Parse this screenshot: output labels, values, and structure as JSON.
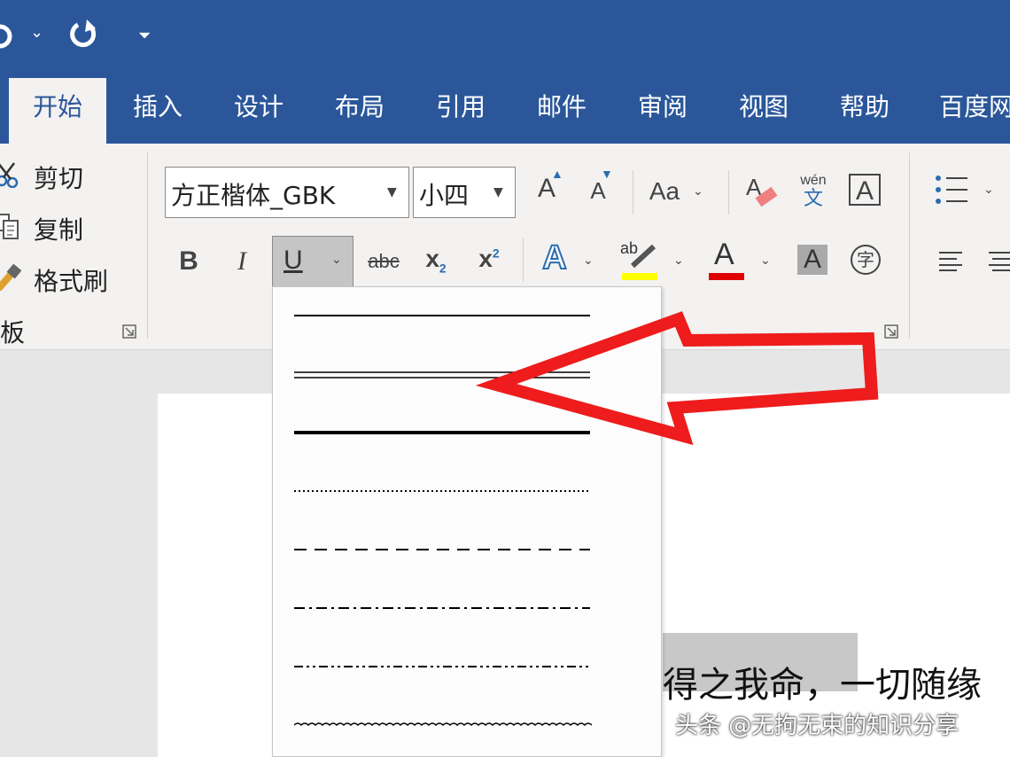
{
  "quick_access": {
    "undo_icon": "undo-icon",
    "redo_icon": "redo-icon",
    "customize_icon": "customize-qat-icon"
  },
  "tabs": [
    "开始",
    "插入",
    "设计",
    "布局",
    "引用",
    "邮件",
    "审阅",
    "视图",
    "帮助",
    "百度网"
  ],
  "active_tab": "开始",
  "clipboard": {
    "cut": "剪切",
    "copy": "复制",
    "format_painter": "格式刷",
    "group_label": "板"
  },
  "font": {
    "name": "方正楷体_GBK",
    "size": "小四",
    "grow_icon": "A",
    "shrink_icon": "A",
    "change_case": "Aa",
    "phonetic_top": "wén",
    "phonetic_bottom": "文",
    "border_char": "A",
    "bold": "B",
    "italic": "I",
    "underline": "U",
    "strike": "abc",
    "subscript": "x",
    "subscript_mark": "2",
    "superscript": "x",
    "superscript_mark": "2",
    "text_effect": "A",
    "highlight_text": "ab",
    "font_color": "A",
    "char_shading": "A",
    "enclose_char": "字",
    "highlight_color": "#ffff00",
    "font_color_value": "#e00000"
  },
  "underline_menu": {
    "options": [
      "single",
      "double",
      "thick",
      "dotted",
      "dashed",
      "dash-dot",
      "dash-dot-dot",
      "wave"
    ]
  },
  "document": {
    "text": "得之我命，一切随缘",
    "watermark": "头条 @无拘无束的知识分享"
  },
  "colors": {
    "ribbon_blue": "#2b579a",
    "arrow_red": "#ee1c1c"
  }
}
